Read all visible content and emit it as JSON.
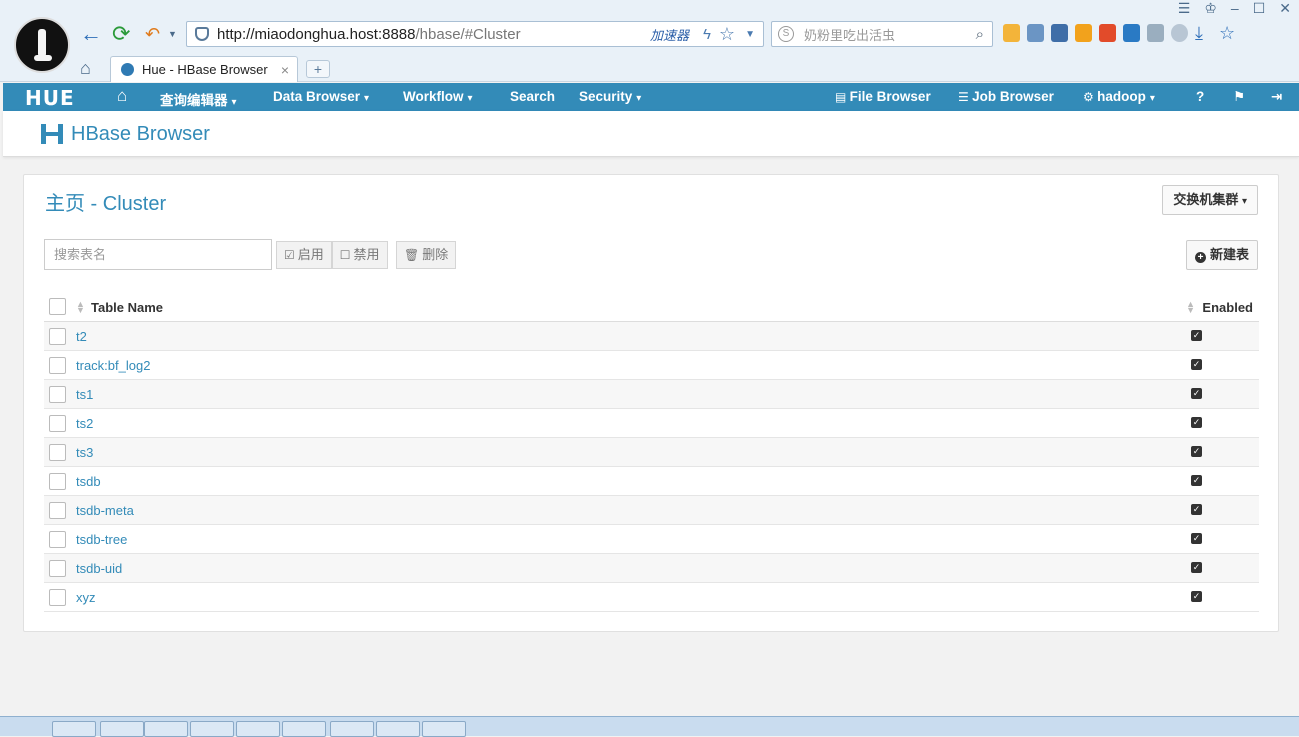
{
  "browser": {
    "url_host": "http://miaodonghua.host:8888",
    "url_path": "/hbase/#Cluster",
    "accelerator_label": "加速器",
    "search_placeholder": "奶粉里吃出活虫",
    "tab_title": "Hue - HBase Browser",
    "tab_close": "×",
    "new_tab": "+"
  },
  "hue_nav": {
    "brand": "HUE",
    "items": [
      {
        "label": "查询编辑器",
        "caret": "▾"
      },
      {
        "label": "Data Browser",
        "caret": "▾"
      },
      {
        "label": "Workflow",
        "caret": "▾"
      },
      {
        "label": "Search"
      },
      {
        "label": "Security",
        "caret": "▾"
      }
    ],
    "right_items": [
      {
        "label": "File Browser"
      },
      {
        "label": "Job Browser"
      },
      {
        "label": "hadoop",
        "caret": "▾"
      }
    ]
  },
  "app": {
    "title": "HBase Browser"
  },
  "cluster": {
    "crumb_home": "主页",
    "crumb_sep": " - ",
    "crumb_cluster": "Cluster",
    "switch_button": "交换机集群",
    "filter_placeholder": "搜索表名",
    "enable_button": "启用",
    "disable_button": "禁用",
    "delete_button": "删除",
    "new_table_button": "新建表"
  },
  "table": {
    "columns": [
      "Table Name",
      "Enabled"
    ],
    "rows": [
      {
        "name": "t2",
        "enabled": true
      },
      {
        "name": "track:bf_log2",
        "enabled": true
      },
      {
        "name": "ts1",
        "enabled": true
      },
      {
        "name": "ts2",
        "enabled": true
      },
      {
        "name": "ts3",
        "enabled": true
      },
      {
        "name": "tsdb",
        "enabled": true
      },
      {
        "name": "tsdb-meta",
        "enabled": true
      },
      {
        "name": "tsdb-tree",
        "enabled": true
      },
      {
        "name": "tsdb-uid",
        "enabled": true
      },
      {
        "name": "xyz",
        "enabled": true
      }
    ]
  },
  "colors": {
    "accent": "#338bb8",
    "nav_bg": "#338bb8"
  }
}
